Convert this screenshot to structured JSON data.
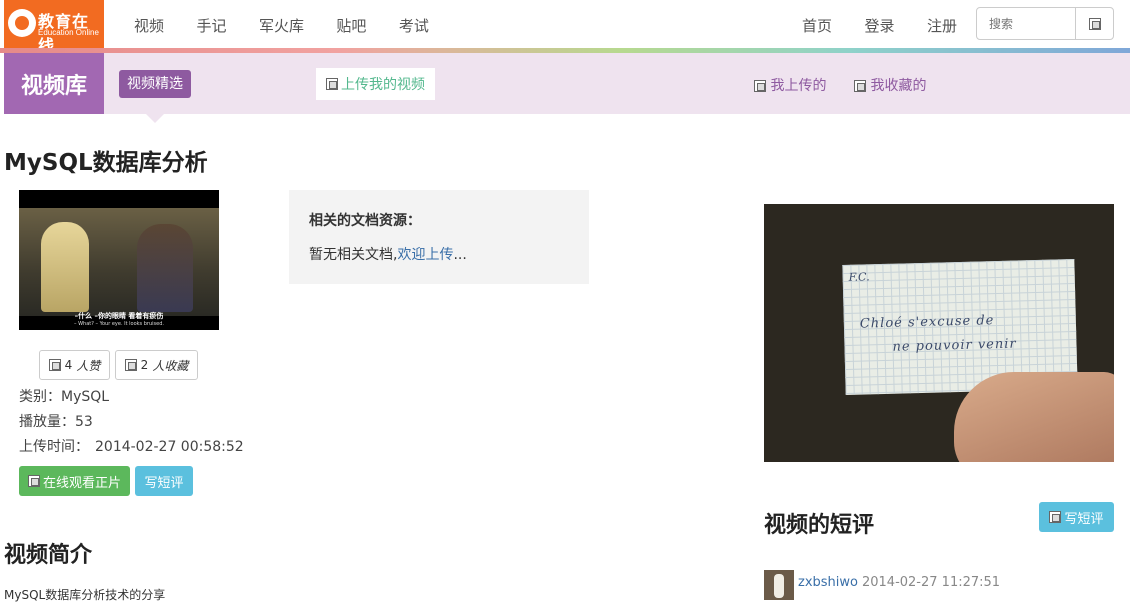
{
  "nav": {
    "logo_title": "教育在线",
    "logo_subtitle": "Education Online",
    "links": [
      "视频",
      "手记",
      "军火库",
      "贴吧",
      "考试"
    ],
    "right_links": [
      "首页",
      "登录",
      "注册"
    ],
    "search_placeholder": "搜索"
  },
  "subheader": {
    "section": "视频库",
    "chip": "视频精选",
    "upload": "上传我的视频",
    "my_uploads": "我上传的",
    "my_favorites": "我收藏的"
  },
  "video": {
    "title": "MySQL数据库分析",
    "subtitle_cn": "–什么 –你的眼睛 看着有瘀伤",
    "subtitle_en": "– What? – Your eye. It looks bruised.",
    "likes_count": "4",
    "likes_label": "人赞",
    "favorites_count": "2",
    "favorites_label": "人收藏",
    "category_label": "类别：",
    "category": "MySQL",
    "plays_label": "播放量：",
    "plays": "53",
    "upload_time_label": "上传时间：",
    "upload_time": "2014-02-27 00:58:52",
    "watch_button": "在线观看正片",
    "review_button": "写短评"
  },
  "intro": {
    "heading": "视频简介",
    "text": "MySQL数据库分析技术的分享"
  },
  "docs": {
    "title": "相关的文档资源：",
    "empty_text": "暂无相关文档,",
    "upload_link": "欢迎上传",
    "ellipsis": "..."
  },
  "poster": {
    "card_line0": "F.C.",
    "card_line1": "Chloé  s'excuse  de",
    "card_line2": "ne  pouvoir  venir"
  },
  "reviews": {
    "heading": "视频的短评",
    "write_button": "写短评",
    "items": [
      {
        "user": "zxbshiwo",
        "time": "2014-02-27 11:27:51"
      }
    ]
  }
}
